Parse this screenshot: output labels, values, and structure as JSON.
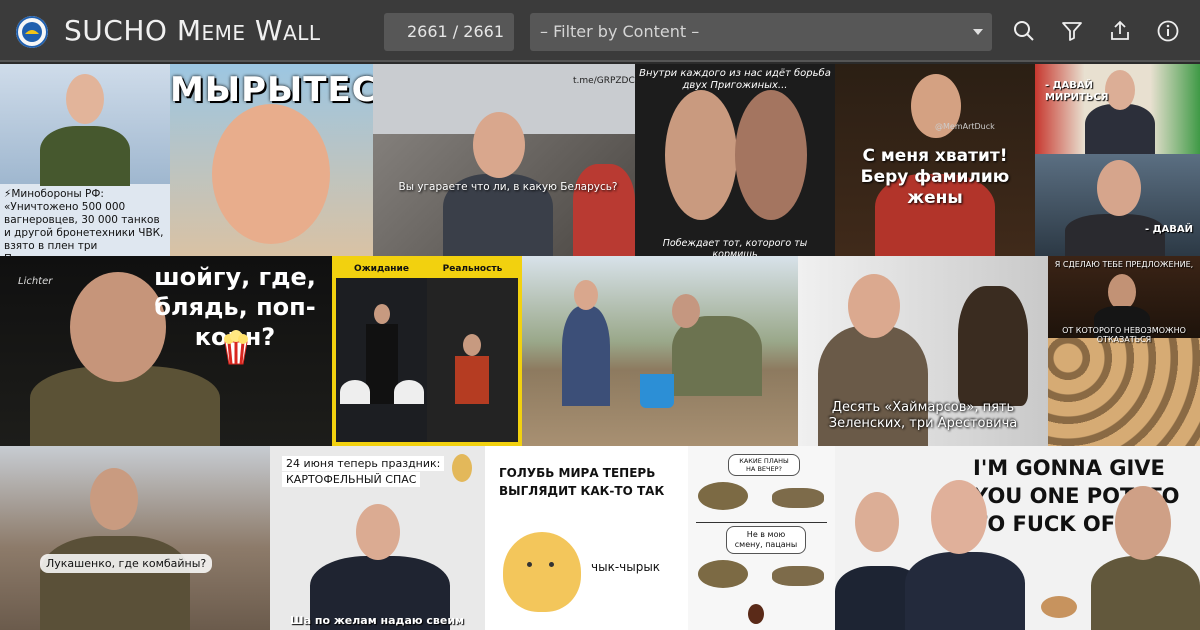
{
  "app": {
    "title_prefix": "SUCHO",
    "title_rest": "Meme Wall"
  },
  "counter": {
    "text": "2661 / 2661"
  },
  "filter": {
    "placeholder": "– Filter by Content –"
  },
  "toolbar": {
    "icons": [
      "search-icon",
      "filter-icon",
      "share-icon",
      "info-icon"
    ]
  },
  "colors": {
    "topbar": "#3b3b3b",
    "field": "#575757",
    "accent_yellow": "#f2d10f"
  },
  "memes": {
    "t1": {
      "caption": "⚡Минобороны РФ: «Уничтожено 500 000 вагнеровцев, 30 000 танков и другой бронетехники ЧВК, взято в плен три Пригожина»"
    },
    "t2": {
      "caption": "МЫРЫТЕС"
    },
    "t3": {
      "caption": "Вы угараете что ли, в какую Беларусь?",
      "watermark": "t.me/GRPZDC"
    },
    "t4": {
      "top": "Внутри каждого из нас идёт борьба двух Пригожиных...",
      "bottom": "Побеждает тот, которого ты кормишь"
    },
    "t5": {
      "caption": "С меня хватит! Беру фамилию жены",
      "watermark": "@MemArtDuck"
    },
    "t6": {
      "top": "- ДАВАЙ МИРИТЬСЯ",
      "bottom": "- ДАВАЙ"
    },
    "t7": {
      "caption": "шойгу, где, блядь, поп-корн?",
      "sig": "Lichter"
    },
    "t8": {
      "left": "Ожидание",
      "right": "Реальность"
    },
    "t10": {
      "caption": "Десять «Хаймарсов», пять Зеленских, три Арестовича"
    },
    "t11": {
      "top": "Я СДЕЛАЮ ТЕБЕ ПРЕДЛОЖЕНИЕ,",
      "bottom": "ОТ КОТОРОГО НЕВОЗМОЖНО ОТКАЗАТЬСЯ"
    },
    "t12": {
      "caption": "Лукашенко, где комбайны?"
    },
    "t13": {
      "line1": "24 июня теперь праздник:",
      "line2": "КАРТОФЕЛЬНЫЙ СПАС",
      "bottom": "Ша по желам надаю свеим"
    },
    "t14": {
      "caption": "ГОЛУБЬ МИРА ТЕПЕРЬ ВЫГЛЯДИТ КАК-ТО ТАК",
      "chirp": "чык-чырык"
    },
    "t15": {
      "bubble1": "КАКИЕ ПЛАНЫ НА ВЕЧЕР?",
      "bubble2": "Не в мою смену, пацаны"
    },
    "t16": {
      "caption": "I'M GONNA GIVE YOU ONE POTATO TO FUCK OFF"
    }
  }
}
